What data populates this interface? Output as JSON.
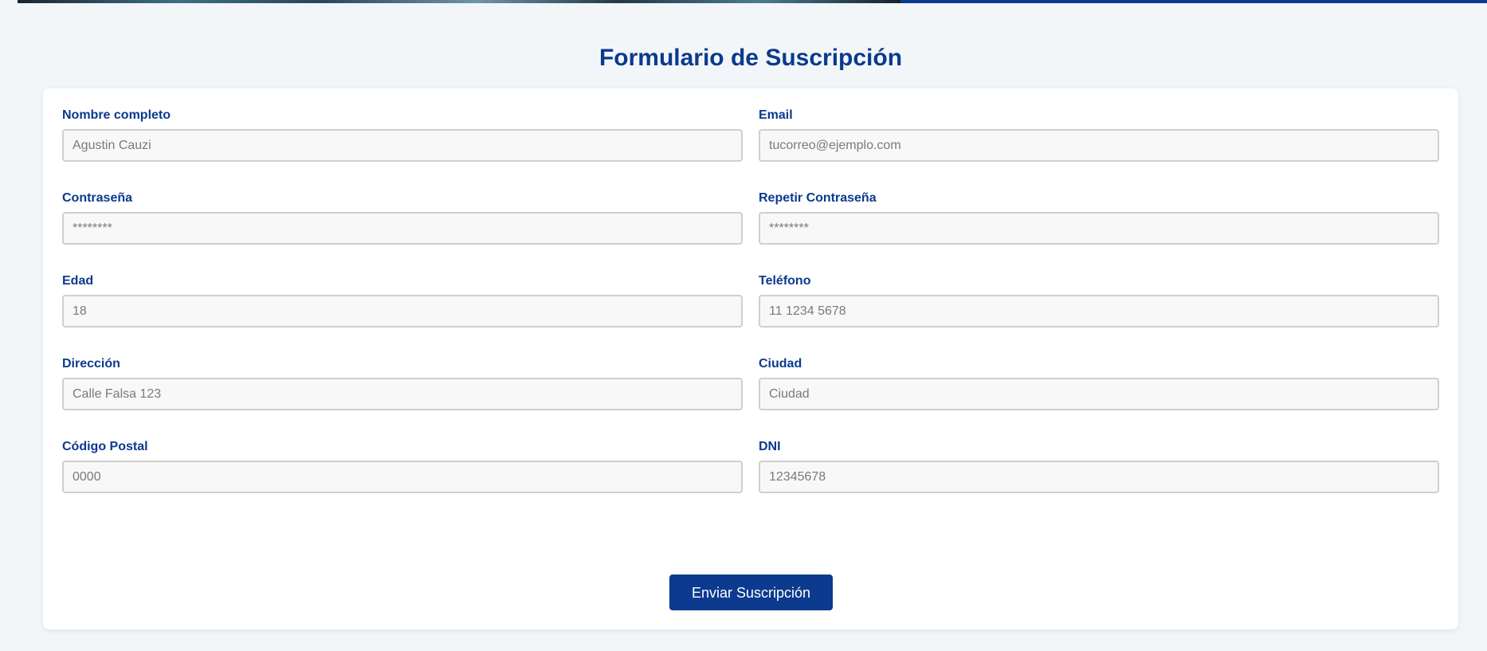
{
  "header": {
    "title": "Formulario de Suscripción"
  },
  "form": {
    "fields": [
      {
        "label": "Nombre completo",
        "placeholder": "Agustin Cauzi"
      },
      {
        "label": "Email",
        "placeholder": "tucorreo@ejemplo.com"
      },
      {
        "label": "Contraseña",
        "placeholder": "********"
      },
      {
        "label": "Repetir Contraseña",
        "placeholder": "********"
      },
      {
        "label": "Edad",
        "placeholder": "18"
      },
      {
        "label": "Teléfono",
        "placeholder": "11 1234 5678"
      },
      {
        "label": "Dirección",
        "placeholder": "Calle Falsa 123"
      },
      {
        "label": "Ciudad",
        "placeholder": "Ciudad"
      },
      {
        "label": "Código Postal",
        "placeholder": "0000"
      },
      {
        "label": "DNI",
        "placeholder": "12345678"
      }
    ],
    "submit_label": "Enviar Suscripción"
  },
  "colors": {
    "brand": "#0b3a8e",
    "background": "#f3f6f9",
    "card": "#ffffff",
    "input_background": "#f8f8f8",
    "input_border": "#cfcfcf"
  }
}
